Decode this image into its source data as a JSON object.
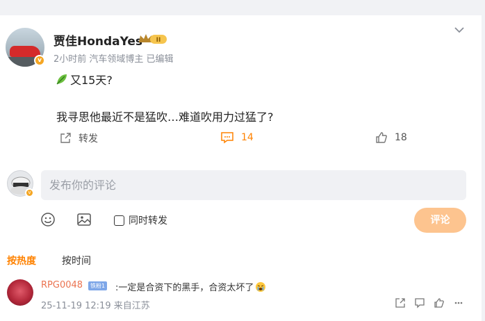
{
  "post": {
    "username": "贾佳HondaYes",
    "level_badge": "II",
    "meta": "2小时前  汽车领域博主  已编辑",
    "line1": "又15天?",
    "line2": "我寻思他最近不是猛吹…难道吹用力过猛了?",
    "actions": {
      "repost_label": "转发",
      "comment_count": "14",
      "like_count": "18"
    }
  },
  "comment_box": {
    "placeholder": "发布你的评论",
    "also_repost_label": "同时转发",
    "submit_label": "评论"
  },
  "sort": {
    "hot_label": "按热度",
    "time_label": "按时间"
  },
  "reply": {
    "username": "RPG0048",
    "fan_badge": "铁粉1",
    "text": ":一定是合资下的黑手，合资太坏了",
    "meta": "25-11-19 12:19 来自江苏"
  },
  "colors": {
    "accent": "#ff8200",
    "button_disabled": "#fdc48f",
    "reply_username": "#eb7350"
  }
}
